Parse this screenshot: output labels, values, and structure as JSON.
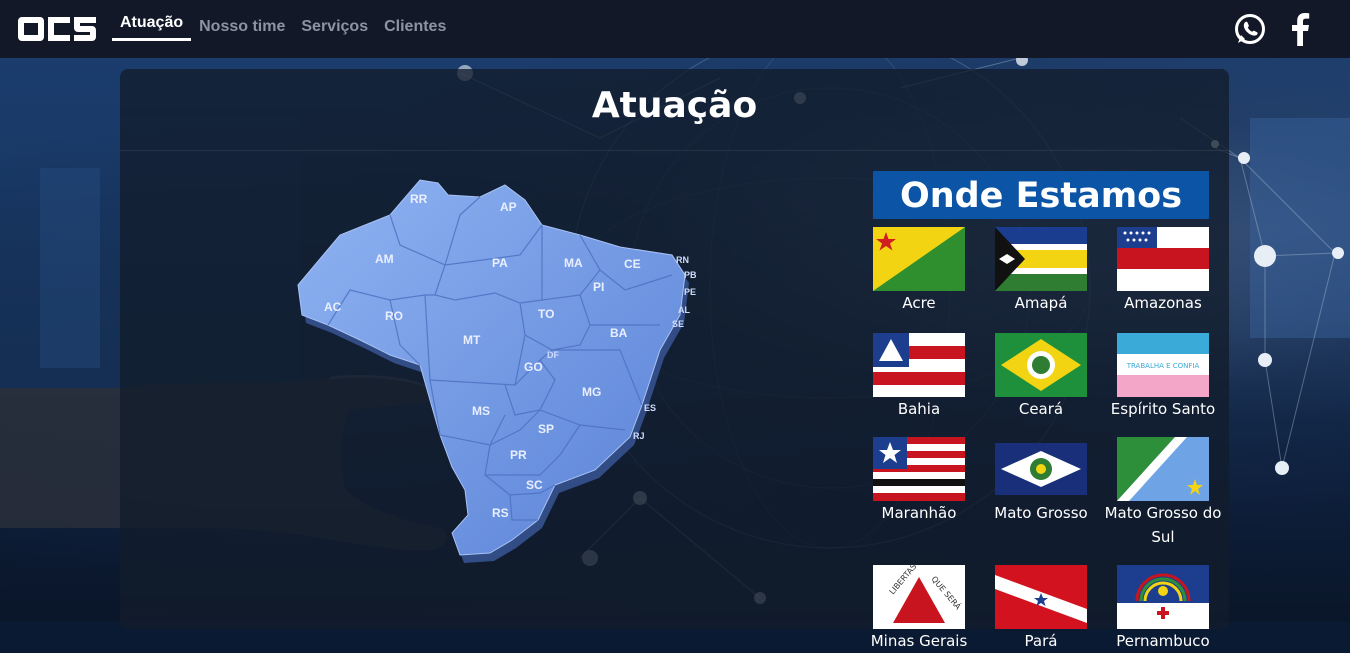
{
  "nav": {
    "logo_text": "OCS",
    "links": [
      "Atuação",
      "Nosso time",
      "Serviços",
      "Clientes"
    ],
    "active": "Atuação"
  },
  "social": [
    "whatsapp-icon",
    "facebook-icon"
  ],
  "page": {
    "title": "Atuação"
  },
  "map": {
    "states": [
      "RR",
      "AP",
      "AM",
      "PA",
      "MA",
      "CE",
      "RN",
      "PB",
      "PE",
      "AL",
      "SE",
      "PI",
      "AC",
      "RO",
      "TO",
      "BA",
      "MT",
      "DF",
      "GO",
      "MG",
      "ES",
      "RJ",
      "MS",
      "SP",
      "PR",
      "SC",
      "RS"
    ]
  },
  "onde": {
    "title": "Onde Estamos",
    "states": [
      {
        "name": "Acre"
      },
      {
        "name": "Amapá"
      },
      {
        "name": "Amazonas"
      },
      {
        "name": "Bahia"
      },
      {
        "name": "Ceará"
      },
      {
        "name": "Espírito Santo"
      },
      {
        "name": "Maranhão"
      },
      {
        "name": "Mato Grosso"
      },
      {
        "name": "Mato Grosso do Sul"
      },
      {
        "name": "Minas Gerais"
      },
      {
        "name": "Pará"
      },
      {
        "name": "Pernambuco"
      }
    ]
  },
  "colors": {
    "navbar": "#121827",
    "accent": "#0c55a6",
    "map": "#6f98e6"
  }
}
